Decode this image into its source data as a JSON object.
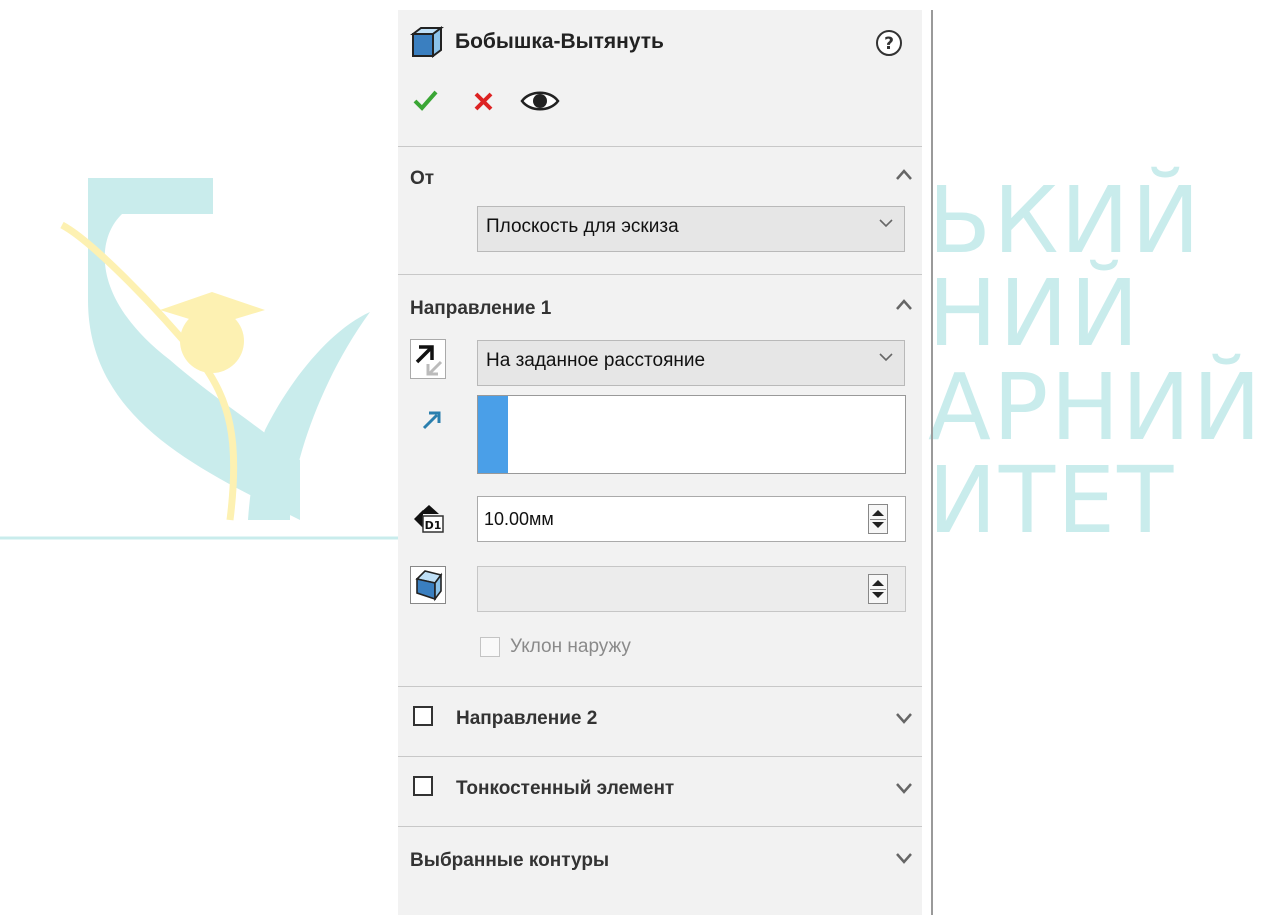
{
  "watermark": {
    "lines": [
      "ЬКИЙ",
      "НИЙ",
      "АРНИЙ",
      "ИТЕТ"
    ]
  },
  "panel": {
    "title": "Бобышка-Вытянуть",
    "sections": {
      "from": {
        "label": "От",
        "combo_value": "Плоскость для эскиза"
      },
      "direction1": {
        "label": "Направление 1",
        "end_condition": "На заданное расстояние",
        "depth_value": "10.00мм",
        "draft_value": "",
        "draft_outward_label": "Уклон наружу"
      },
      "direction2": {
        "label": "Направление 2"
      },
      "thin_feature": {
        "label": "Тонкостенный элемент"
      },
      "selected_contours": {
        "label": "Выбранные контуры"
      }
    }
  },
  "colors": {
    "accent_blue": "#4a9fe8",
    "ok_green": "#3aa635",
    "cancel_red": "#d22",
    "watermark": "#c9ecec",
    "logo_yellow": "#fdf1b2"
  }
}
